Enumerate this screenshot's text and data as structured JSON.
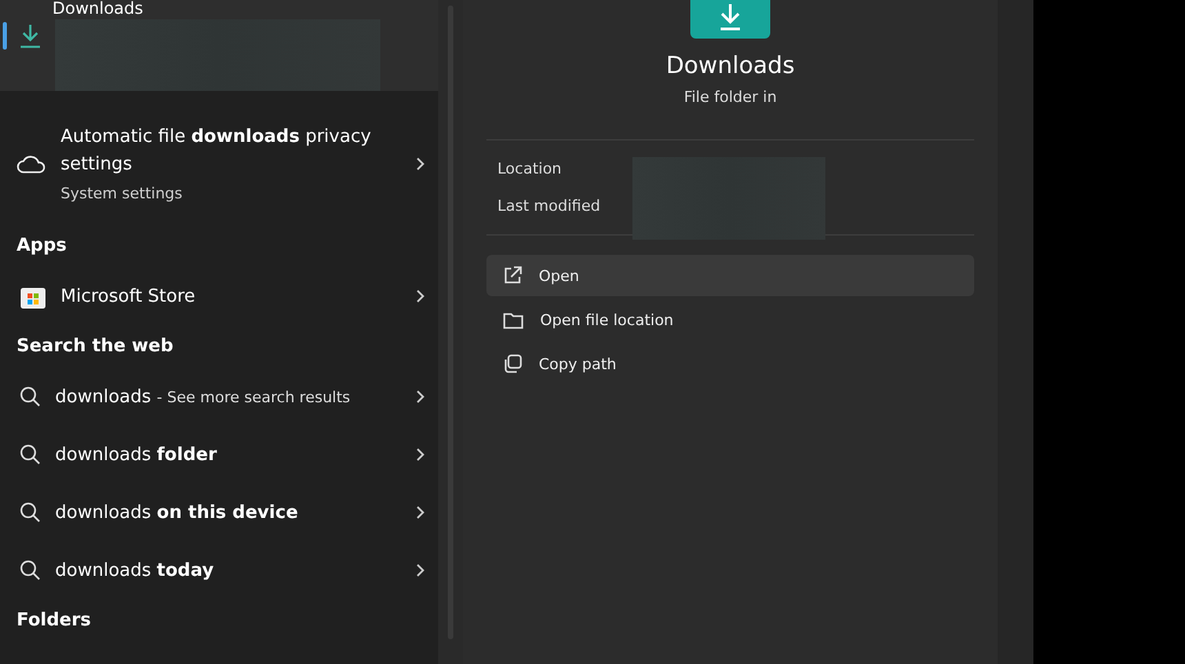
{
  "top_result": {
    "title": "Downloads",
    "selected": true
  },
  "best_settings": {
    "title": "Automatic file **downloads** privacy settings",
    "subtitle": "System settings"
  },
  "sections": [
    {
      "heading": "Apps",
      "items": [
        {
          "kind": "app",
          "text": "Microsoft Store"
        }
      ]
    },
    {
      "heading": "Search the web",
      "items": [
        {
          "kind": "web",
          "text": "downloads - See more search results"
        },
        {
          "kind": "web",
          "text": "downloads **folder**"
        },
        {
          "kind": "web",
          "text": "downloads **on this device**"
        },
        {
          "kind": "web",
          "text": "downloads **today**"
        }
      ]
    },
    {
      "heading": "Folders"
    }
  ],
  "preview": {
    "title": "Downloads",
    "subtitle": "File folder in",
    "details": [
      {
        "label": "Location"
      },
      {
        "label": "Last modified"
      }
    ],
    "actions": [
      {
        "kind": "open",
        "label": "Open",
        "selected": true
      },
      {
        "kind": "folder",
        "label": "Open file location",
        "selected": false
      },
      {
        "kind": "copy",
        "label": "Copy path",
        "selected": false
      }
    ]
  }
}
